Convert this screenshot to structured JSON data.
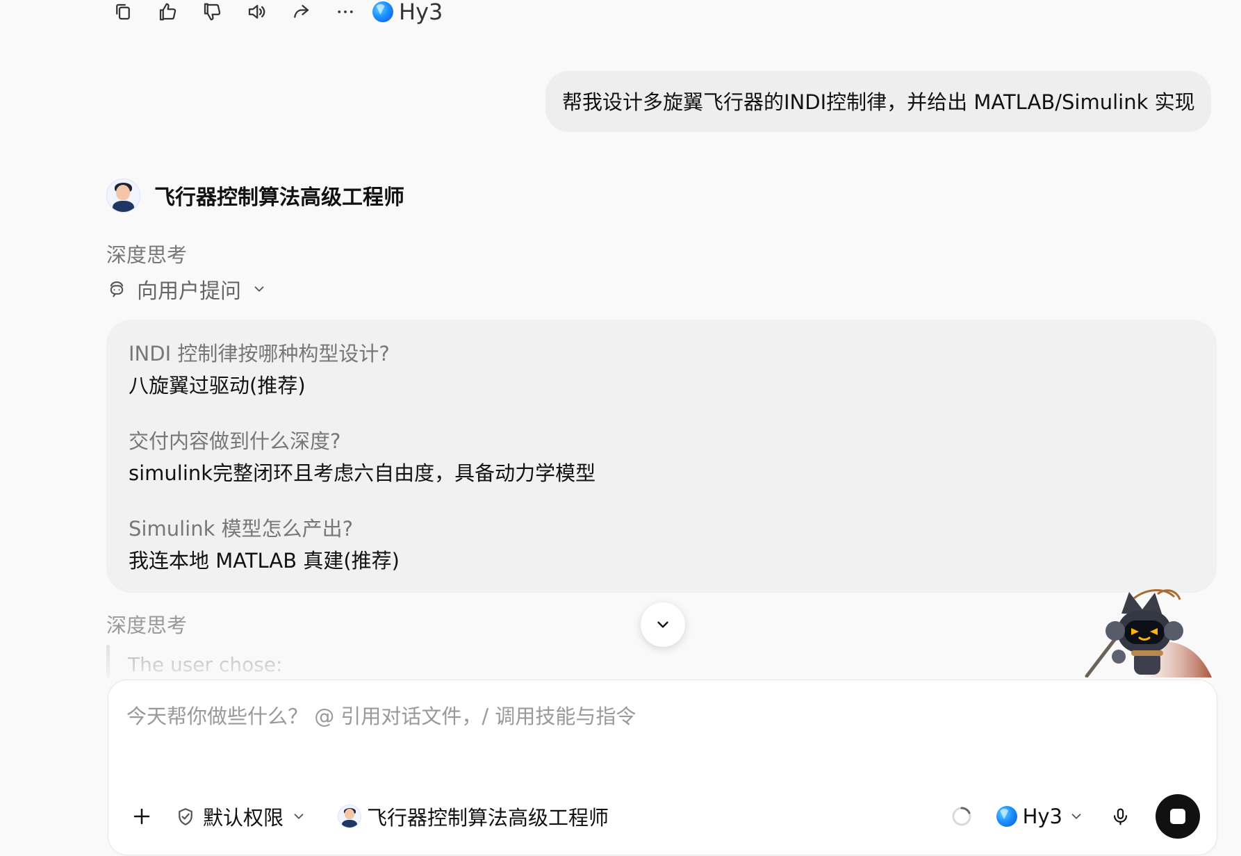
{
  "message_actions": {
    "items": [
      "copy-icon",
      "thumbs-up-icon",
      "thumbs-down-icon",
      "speaker-icon",
      "share-icon",
      "more-icon"
    ],
    "model": "Hy3"
  },
  "user_message": {
    "text": "帮我设计多旋翼飞行器的INDI控制律，并给出 MATLAB/Simulink 实现"
  },
  "assistant": {
    "name": "飞行器控制算法高级工程师",
    "avatar_icon": "engineer-avatar-icon",
    "thinking_label": "深度思考",
    "ask_user_label": "向用户提问",
    "ask_user_icon": "chat-robot-icon"
  },
  "questions": [
    {
      "question": "INDI 控制律按哪种构型设计?",
      "answer": "八旋翼过驱动(推荐)"
    },
    {
      "question": "交付内容做到什么深度?",
      "answer": "simulink完整闭环且考虑六自由度，具备动力学模型"
    },
    {
      "question": "Simulink 模型怎么产出?",
      "answer": "我连本地 MATLAB 真建(推荐)"
    }
  ],
  "thinking_stream": {
    "title": "深度思考",
    "preview": "The user chose:"
  },
  "composer": {
    "placeholder": "今天帮你做些什么？ @ 引用对话文件，/ 调用技能与指令",
    "permission": "默认权限",
    "agent": "飞行器控制算法高级工程师",
    "model": "Hy3"
  },
  "colors": {
    "page_background": "#f9f9f9",
    "bubble_background": "#eeeeee",
    "card_background": "#f1f1f1",
    "muted_text": "#777777",
    "accent_blue": "#1d8fff",
    "stop_button": "#111111"
  }
}
